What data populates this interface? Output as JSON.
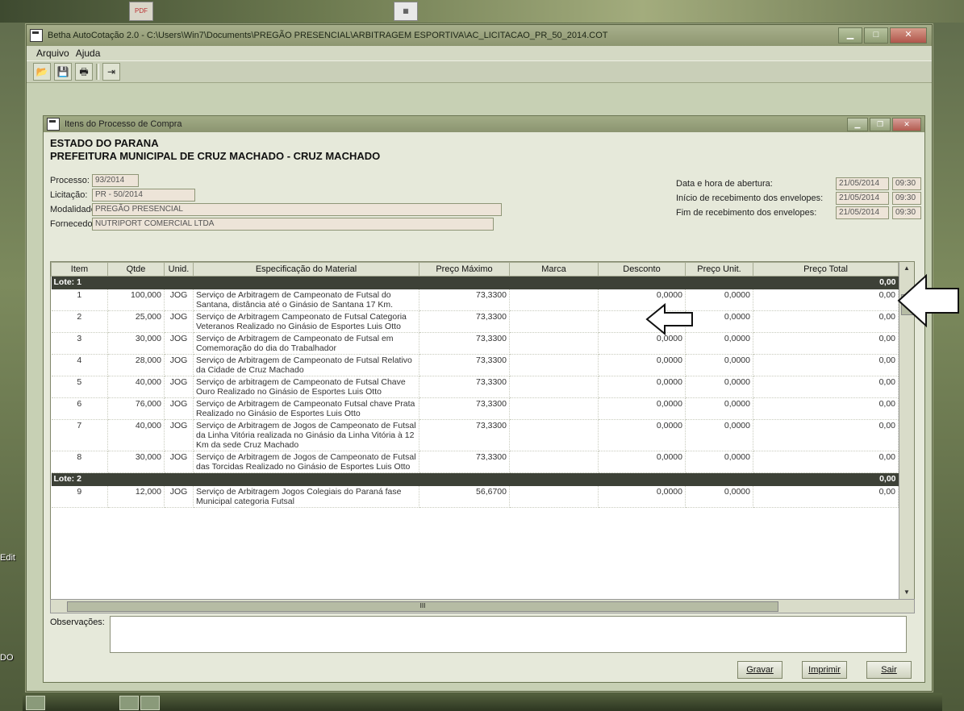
{
  "desktop": {
    "labels": [
      "Edit",
      "DO"
    ]
  },
  "window": {
    "title": "Betha AutoCotação 2.0 - C:\\Users\\Win7\\Documents\\PREGÃO PRESENCIAL\\ARBITRAGEM ESPORTIVA\\AC_LICITACAO_PR_50_2014.COT",
    "menu": [
      "Arquivo",
      "Ajuda"
    ]
  },
  "child": {
    "title": "Itens do Processo de Compra",
    "state": "ESTADO DO PARANA",
    "prefeitura": "PREFEITURA MUNICIPAL DE CRUZ MACHADO - CRUZ MACHADO",
    "fields": {
      "processo_label": "Processo:",
      "processo": "93/2014",
      "licitacao_label": "Licitação:",
      "licitacao": "PR - 50/2014",
      "modalidade_label": "Modalidade:",
      "modalidade": "PREGÃO PRESENCIAL",
      "fornecedor_label": "Fornecedor:",
      "fornecedor": "NUTRIPORT COMERCIAL LTDA"
    },
    "dates": {
      "abertura_label": "Data e hora de abertura:",
      "abertura_date": "21/05/2014",
      "abertura_time": "09:30",
      "inicio_label": "Início de recebimento dos envelopes:",
      "inicio_date": "21/05/2014",
      "inicio_time": "09:30",
      "fim_label": "Fim de recebimento dos envelopes:",
      "fim_date": "21/05/2014",
      "fim_time": "09:30"
    },
    "columns": [
      "Item",
      "Qtde",
      "Unid.",
      "Especificação do Material",
      "Preço Máximo",
      "Marca",
      "Desconto",
      "Preço Unit.",
      "Preço Total"
    ],
    "lote1": {
      "label": "Lote: 1",
      "total": "0,00"
    },
    "lote2": {
      "label": "Lote: 2",
      "total": "0,00"
    },
    "rows1": [
      {
        "item": "1",
        "qtde": "100,000",
        "unid": "JOG",
        "esp": "Serviço de Arbitragem de Campeonato de Futsal do Santana, distância até o Ginásio de Santana 17 Km.",
        "max": "73,3300",
        "marca": "",
        "desc": "0,0000",
        "unit": "0,0000",
        "total": "0,00"
      },
      {
        "item": "2",
        "qtde": "25,000",
        "unid": "JOG",
        "esp": "Serviço de Arbitragem Campeonato de Futsal Categoria Veteranos Realizado no Ginásio de Esportes Luis Otto",
        "max": "73,3300",
        "marca": "",
        "desc": "0",
        "unit": "0,0000",
        "total": "0,00"
      },
      {
        "item": "3",
        "qtde": "30,000",
        "unid": "JOG",
        "esp": "Serviço de Arbitragem de Campeonato de Futsal em Comemoração do dia do Trabalhador",
        "max": "73,3300",
        "marca": "",
        "desc": "0,0000",
        "unit": "0,0000",
        "total": "0,00"
      },
      {
        "item": "4",
        "qtde": "28,000",
        "unid": "JOG",
        "esp": "Serviço de Arbitragem de Campeonato de Futsal Relativo da Cidade de Cruz Machado",
        "max": "73,3300",
        "marca": "",
        "desc": "0,0000",
        "unit": "0,0000",
        "total": "0,00"
      },
      {
        "item": "5",
        "qtde": "40,000",
        "unid": "JOG",
        "esp": "Serviço de arbitragem de Campeonato de Futsal Chave Ouro Realizado no Ginásio de Esportes Luis Otto",
        "max": "73,3300",
        "marca": "",
        "desc": "0,0000",
        "unit": "0,0000",
        "total": "0,00"
      },
      {
        "item": "6",
        "qtde": "76,000",
        "unid": "JOG",
        "esp": "Serviço de Arbitragem de Campeonato Futsal chave Prata Realizado no Ginásio de Esportes Luis Otto",
        "max": "73,3300",
        "marca": "",
        "desc": "0,0000",
        "unit": "0,0000",
        "total": "0,00"
      },
      {
        "item": "7",
        "qtde": "40,000",
        "unid": "JOG",
        "esp": "Serviço de Arbitragem de Jogos de Campeonato de Futsal da Linha Vitória realizada no Ginásio da Linha Vitória à 12 Km da sede Cruz Machado",
        "max": "73,3300",
        "marca": "",
        "desc": "0,0000",
        "unit": "0,0000",
        "total": "0,00"
      },
      {
        "item": "8",
        "qtde": "30,000",
        "unid": "JOG",
        "esp": "Serviço de Arbitragem de Jogos de Campeonato de Futsal das Torcidas Realizado no Ginásio de Esportes Luis Otto",
        "max": "73,3300",
        "marca": "",
        "desc": "0,0000",
        "unit": "0,0000",
        "total": "0,00"
      }
    ],
    "rows2": [
      {
        "item": "9",
        "qtde": "12,000",
        "unid": "JOG",
        "esp": "Serviço de Arbitragem Jogos Colegiais do Paraná fase Municipal categoria Futsal",
        "max": "56,6700",
        "marca": "",
        "desc": "0,0000",
        "unit": "0,0000",
        "total": "0,00"
      }
    ],
    "scroll_marker": "III",
    "obs_label": "Observações:",
    "buttons": {
      "gravar": "Gravar",
      "imprimir": "Imprimir",
      "sair": "Sair"
    }
  }
}
